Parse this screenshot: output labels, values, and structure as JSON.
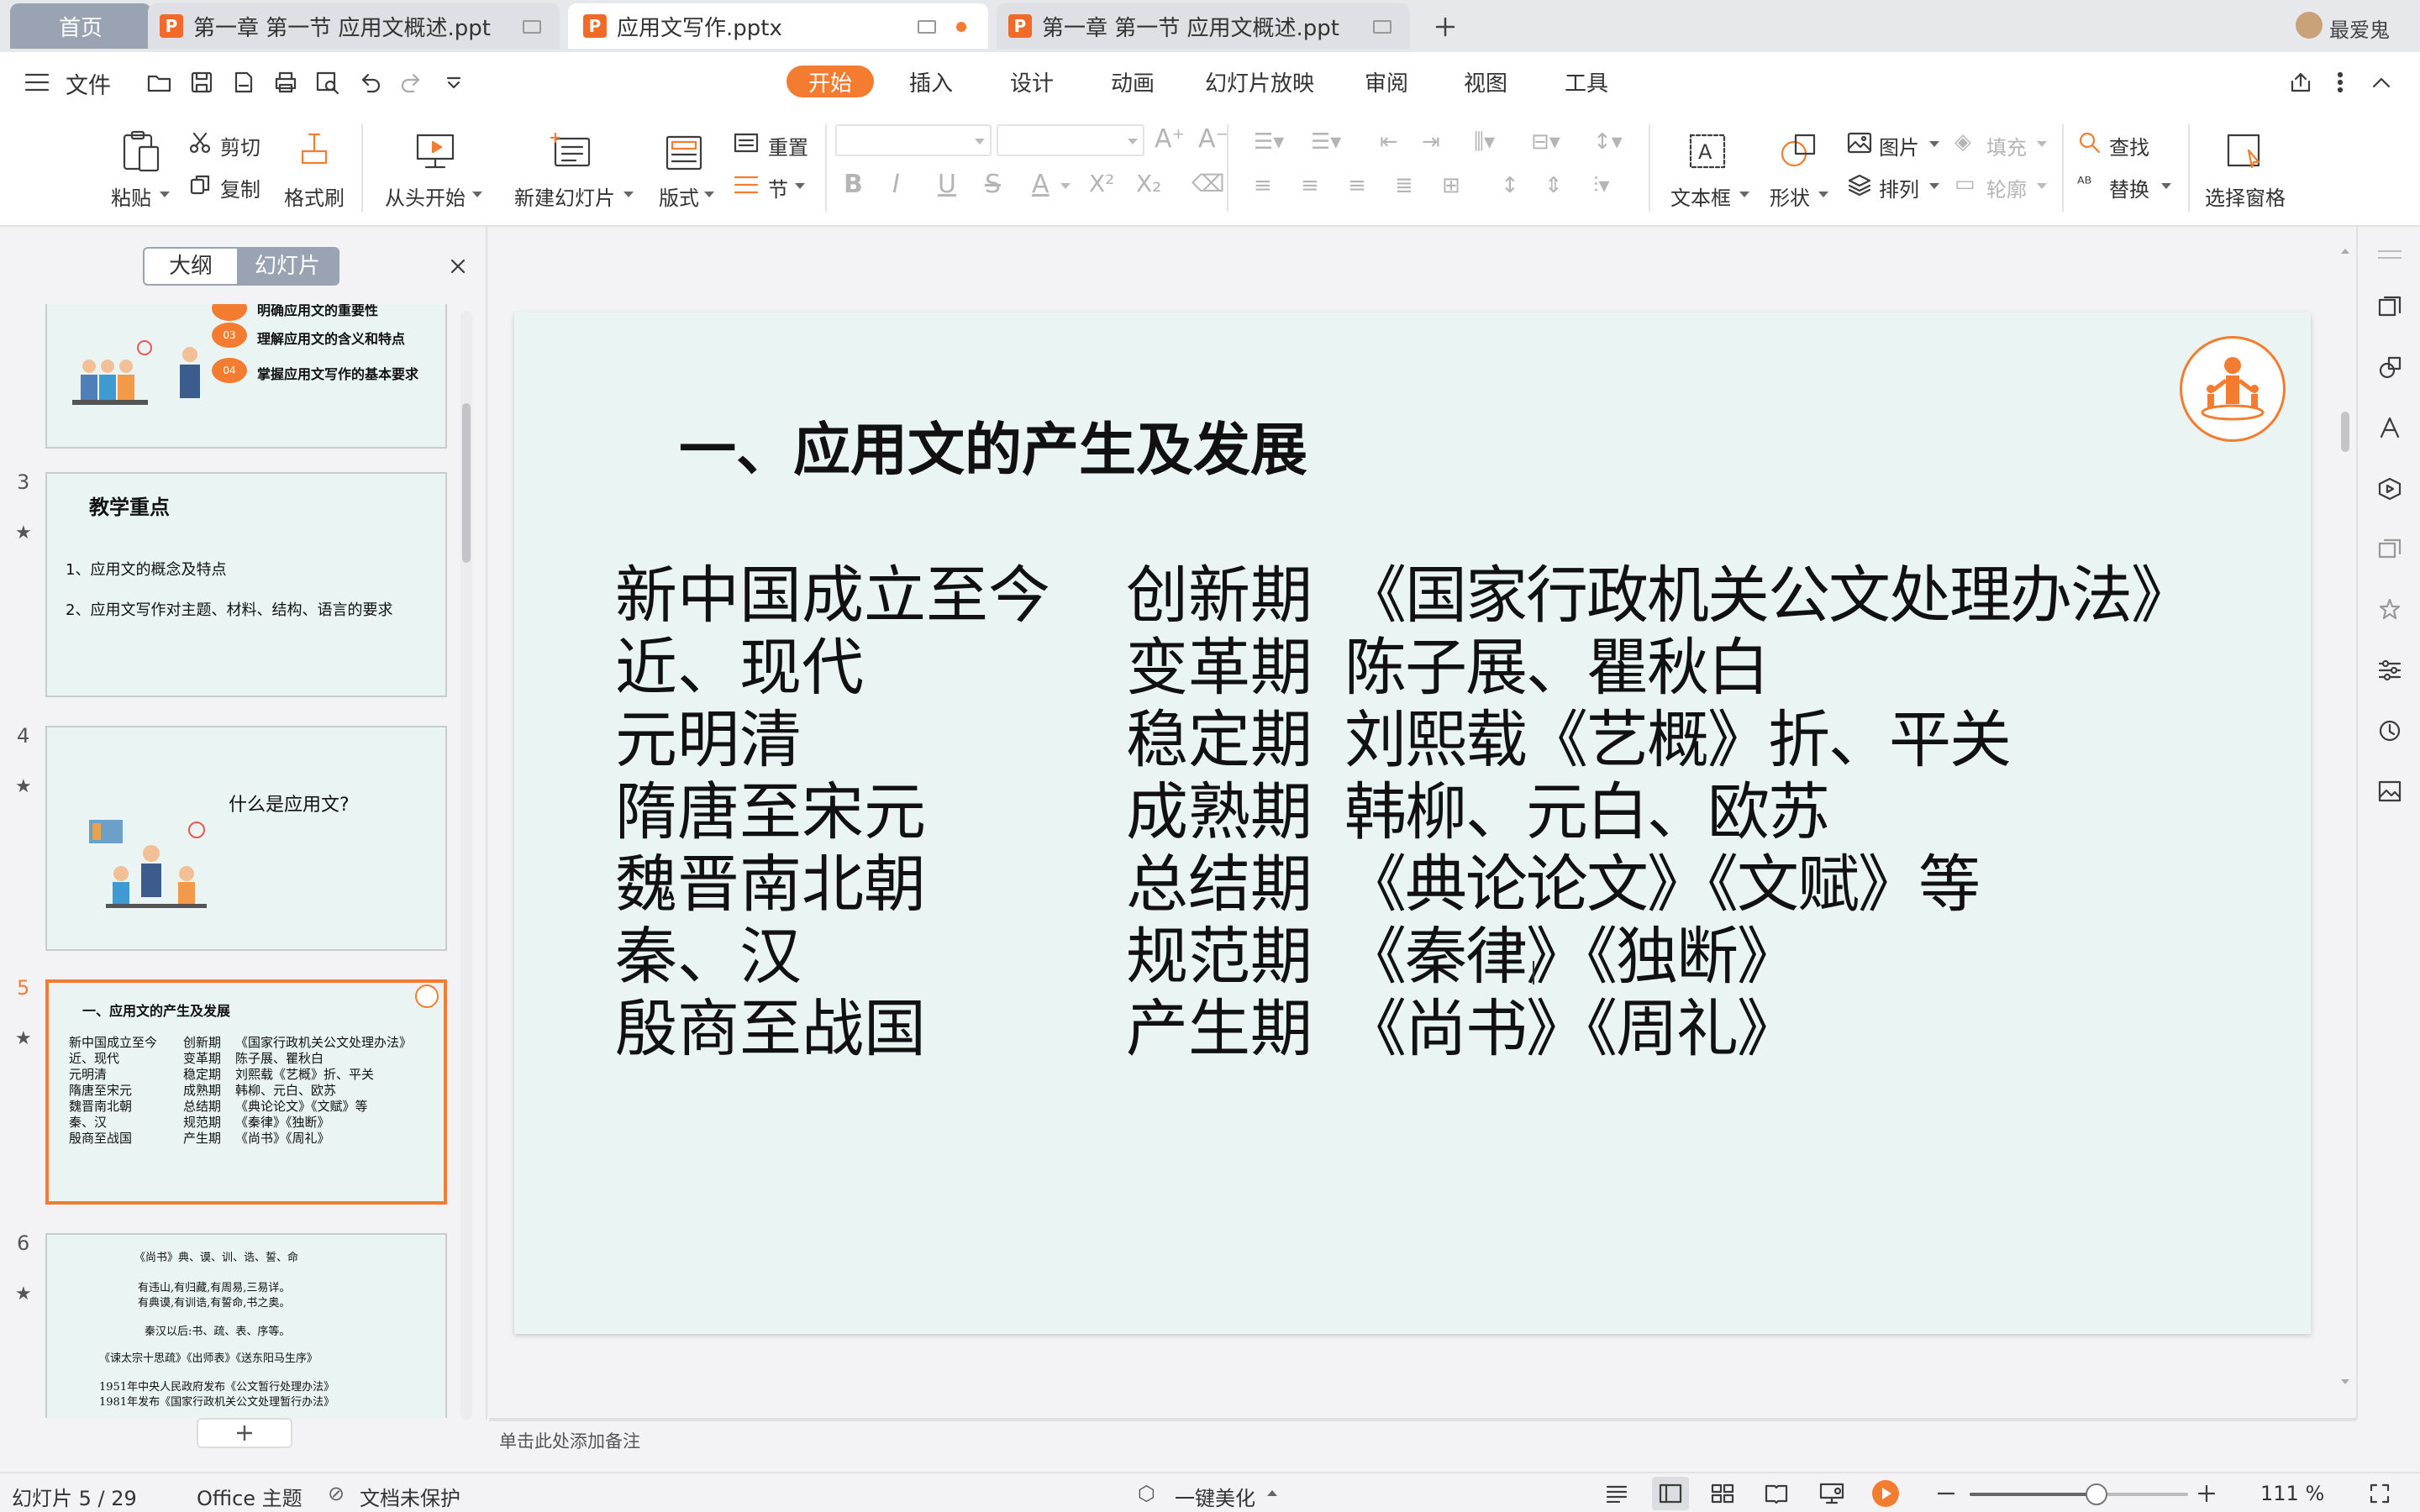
{
  "tabs": {
    "home": "首页",
    "doc1": "第一章 第一节 应用文概述.ppt",
    "doc2": "应用文写作.pptx",
    "doc3": "第一章 第一节 应用文概述.ppt",
    "user": "最爱鬼"
  },
  "menu": {
    "file": "文件",
    "tabs": [
      "开始",
      "插入",
      "设计",
      "动画",
      "幻灯片放映",
      "审阅",
      "视图",
      "工具"
    ],
    "active_tab": "开始"
  },
  "ribbon": {
    "paste": "粘贴",
    "cut": "剪切",
    "copy": "复制",
    "format_painter": "格式刷",
    "from_start": "从头开始",
    "new_slide": "新建幻灯片",
    "layout": "版式",
    "reset": "重置",
    "section": "节",
    "text_box": "文本框",
    "shape": "形状",
    "picture": "图片",
    "fill": "填充",
    "arrange": "排列",
    "outline": "轮廓",
    "find": "查找",
    "replace": "替换",
    "select_pane": "选择窗格"
  },
  "left_pane": {
    "outline_tab": "大纲",
    "slides_tab": "幻灯片",
    "slide2": {
      "item1": "明确应用文的重要性",
      "item2": "理解应用文的含义和特点",
      "item3": "掌握应用文写作的基本要求",
      "n2": "03",
      "n3": "04"
    },
    "slide3": {
      "num": "3",
      "title": "教学重点",
      "l1": "1、应用文的概念及特点",
      "l2": "2、应用文写作对主题、材料、结构、语言的要求"
    },
    "slide4": {
      "num": "4",
      "title": "什么是应用文?"
    },
    "slide5": {
      "num": "5"
    },
    "slide6": {
      "num": "6",
      "lines": [
        "《尚书》典、谟、训、诰、誓、命",
        "有违山,有归藏,有周易,三易详。",
        "有典谟,有训诰,有誓命,书之奥。",
        "秦汉以后:书、疏、表、序等。",
        "《谏太宗十思疏》《出师表》《送东阳马生序》",
        "1951年中央人民政府发布《公文暂行处理办法》",
        "1981年发布《国家行政机关公文处理暂行办法》"
      ]
    }
  },
  "slide": {
    "title": "一、应用文的产生及发展",
    "periods": [
      "新中国成立至今",
      "近、现代",
      "元明清",
      "隋唐至宋元",
      "魏晋南北朝",
      "秦、汉",
      "殷商至战国"
    ],
    "phases": [
      "创新期",
      "变革期",
      "稳定期",
      "成熟期",
      "总结期",
      "规范期",
      "产生期"
    ],
    "works": [
      "《国家行政机关公文处理办法》",
      "陈子展、瞿秋白",
      "刘熙载《艺概》折、平关",
      "韩柳、元白、欧苏",
      "《典论论文》《文赋》等",
      "《秦律》《独断》",
      "《尚书》《周礼》"
    ]
  },
  "notes_placeholder": "单击此处添加备注",
  "status": {
    "slide_count": "幻灯片 5 / 29",
    "theme": "Office 主题",
    "protect": "文档未保护",
    "beautify": "一键美化",
    "zoom": "111 %",
    "zoom_level_fraction": 0.58
  },
  "colors": {
    "accent": "#f47c30",
    "slide_bg": "#eaf4f3",
    "active_tab": "#f47c30"
  }
}
